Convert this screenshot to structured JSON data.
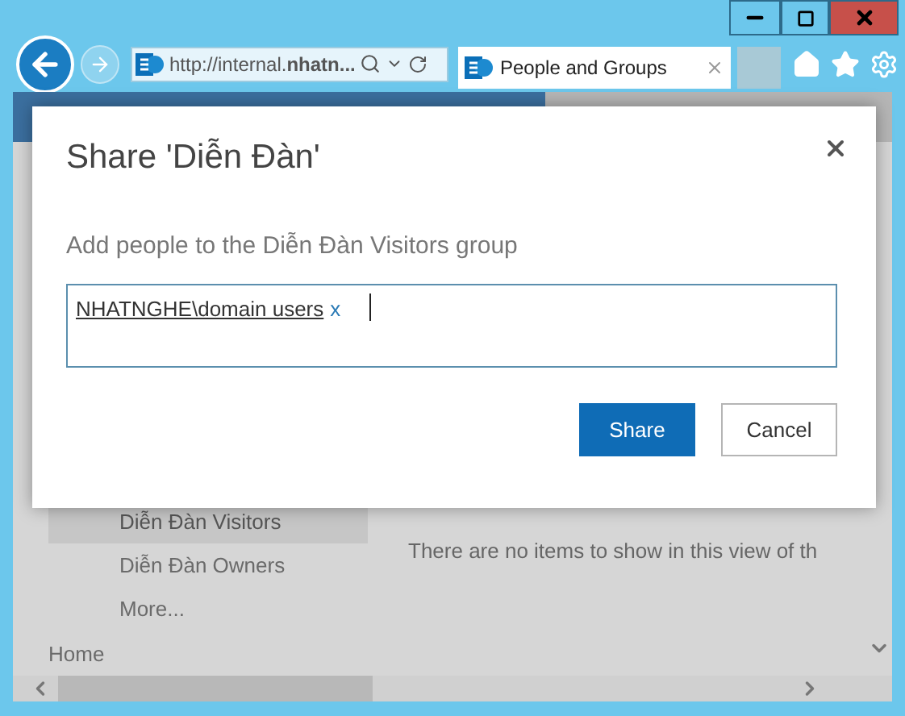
{
  "browser": {
    "address": "http://internal.**nhatn...**",
    "tab": {
      "title": "People and Groups",
      "selected": true
    }
  },
  "page": {
    "sidebar": [
      {
        "label": "Diễn Đàn Visitors",
        "selected": true
      },
      {
        "label": "Diễn Đàn Owners",
        "selected": false
      },
      {
        "label": "More...",
        "selected": false
      },
      {
        "label": "Home",
        "selected": false
      }
    ],
    "empty_message": "There are no items to show in this view of th"
  },
  "dialog": {
    "title": "Share 'Diễn Đàn'",
    "prompt": "Add people to the Diễn Đàn Visitors group",
    "people": [
      {
        "name": "NHATNGHE\\domain users",
        "remove": "x"
      }
    ],
    "buttons": [
      {
        "label": "Share",
        "kind": "primary"
      },
      {
        "label": "Cancel",
        "kind": "secondary"
      }
    ]
  }
}
